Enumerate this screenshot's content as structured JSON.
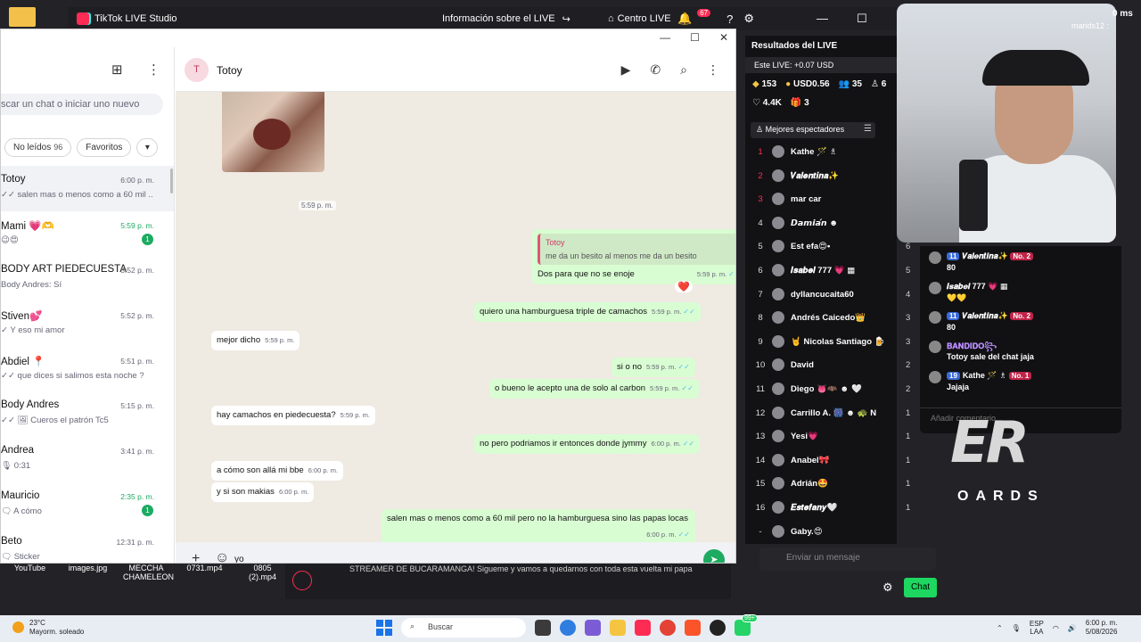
{
  "desktop": {
    "icons": [
      "YouTube",
      "images.jpg",
      "MECCHA CHAMELEON",
      "0731.mp4",
      "0805 (2).mp4"
    ]
  },
  "tiktok": {
    "title": "TikTok LIVE Studio",
    "info": "Información sobre el LIVE",
    "center": "Centro LIVE",
    "notif_count": "67",
    "stream_time": "0 ms"
  },
  "whatsapp": {
    "search_placeholder": "scar un chat o iniciar uno nuevo",
    "filters": [
      {
        "label": "No leídos",
        "count": "96"
      },
      {
        "label": "Favoritos"
      }
    ],
    "chats": [
      {
        "name": "Totoy",
        "time": "6:00 p. m.",
        "preview": "✓✓ salen mas o menos como a 60 mil ...",
        "unread": false
      },
      {
        "name": "Mami 💗🫶",
        "time": "5:59 p. m.",
        "preview": "😉😍",
        "unread": true,
        "badge": "1"
      },
      {
        "name": "BODY ART PIEDECUESTA",
        "time": "5:52 p. m.",
        "preview": "Body Andres: Sí",
        "unread": false
      },
      {
        "name": "Stiven💕",
        "time": "5:52 p. m.",
        "preview": "✓ Y eso mi amor",
        "unread": false
      },
      {
        "name": "Abdiel 📍",
        "time": "5:51 p. m.",
        "preview": "✓✓ que dices si salimos esta noche ?",
        "unread": false
      },
      {
        "name": "Body Andres",
        "time": "5:15 p. m.",
        "preview": "✓✓ 🖼 Cueros el patrón  Tc5",
        "unread": false
      },
      {
        "name": "Andrea",
        "time": "3:41 p. m.",
        "preview": "🎙 0:31",
        "unread": false
      },
      {
        "name": "Mauricio",
        "time": "2:35 p. m.",
        "preview": "🗨 A cómo",
        "unread": true,
        "badge": "1"
      },
      {
        "name": "Beto",
        "time": "12:31 p. m.",
        "preview": "🗨 Sticker",
        "unread": false
      }
    ],
    "conversation": {
      "avatar_letter": "T",
      "name": "Totoy",
      "photo_time": "5:59 p. m.",
      "quote_author": "Totoy",
      "quote_text": "me da un besito al menos me da un besito",
      "messages": [
        {
          "dir": "out",
          "text": "Dos para que no se enoje",
          "time": "5:59 p. m."
        },
        {
          "dir": "out",
          "text": "quiero una hamburguesa triple de camachos",
          "time": "5:59 p. m."
        },
        {
          "dir": "in",
          "text": "mejor dicho",
          "time": "5:59 p. m."
        },
        {
          "dir": "out",
          "text": "si o  no",
          "time": "5:59 p. m."
        },
        {
          "dir": "out",
          "text": "o  bueno le acepto una de solo al carbon",
          "time": "5:59 p. m."
        },
        {
          "dir": "in",
          "text": "hay camachos en piedecuesta?",
          "time": "5:59 p. m."
        },
        {
          "dir": "out",
          "text": "no pero podriamos ir entonces donde jymmy",
          "time": "6:00 p. m."
        },
        {
          "dir": "in",
          "text": "a cómo son allá mi bbe",
          "time": "6:00 p. m."
        },
        {
          "dir": "in",
          "text": "y si son makias",
          "time": "6:00 p. m."
        },
        {
          "dir": "out",
          "text": "salen mas o menos como a 60 mil pero no la hamburguesa sino las papas locas",
          "time": "6:00 p. m."
        }
      ],
      "reaction": "❤️",
      "composer_value": "yo"
    }
  },
  "live_panel": {
    "title": "Resultados del LIVE",
    "earnings": "Este LIVE: +0.07 USD",
    "stats": [
      {
        "icon": "diamond-icon",
        "value": "153"
      },
      {
        "icon": "coin-icon",
        "value": "USD0.56"
      },
      {
        "icon": "viewers-icon",
        "value": "35"
      },
      {
        "icon": "follow-icon",
        "value": "6"
      }
    ],
    "stats2": [
      {
        "icon": "heart-icon",
        "value": "4.4K"
      },
      {
        "icon": "gift-icon",
        "value": "3"
      }
    ],
    "tab": "Mejores espectadores",
    "viewers": [
      {
        "rank": "1",
        "name": "Kathe 🪄 ♗",
        "score": ""
      },
      {
        "rank": "2",
        "name": "𝑽𝒂𝒍𝒆𝒏𝒕𝒊𝒏𝒂✨",
        "score": ""
      },
      {
        "rank": "3",
        "name": "mar car",
        "score": ""
      },
      {
        "rank": "4",
        "name": "𝘿𝙖𝙢𝙞𝙖́𝙣 ☻",
        "score": ""
      },
      {
        "rank": "5",
        "name": "Est efa😍•",
        "score": "6"
      },
      {
        "rank": "6",
        "name": "𝑰𝒔𝒂𝒃𝒆𝒍 777 💗 ▦",
        "score": "5"
      },
      {
        "rank": "7",
        "name": "dyllancucaita60",
        "score": "4"
      },
      {
        "rank": "8",
        "name": "Andrés Caicedo👑",
        "score": "3"
      },
      {
        "rank": "9",
        "name": "🤘 Nicolas Santiago 🍺",
        "score": "3"
      },
      {
        "rank": "10",
        "name": "David",
        "score": "2"
      },
      {
        "rank": "11",
        "name": "Diego 👅🦇 ☻ 🤍",
        "score": "2"
      },
      {
        "rank": "12",
        "name": "Carrillo A. 🎆 ☻ 🐢 N",
        "score": "1"
      },
      {
        "rank": "13",
        "name": "Yesi💗",
        "score": "1"
      },
      {
        "rank": "14",
        "name": "Anabel🎀",
        "score": "1"
      },
      {
        "rank": "15",
        "name": "Adrián🤩",
        "score": "1"
      },
      {
        "rank": "16",
        "name": "𝑬𝒔𝒕𝒆𝒇𝒂𝒏𝒚🤍",
        "score": "1"
      },
      {
        "rank": "-",
        "name": "Gaby.😍",
        "score": ""
      }
    ]
  },
  "cam": {
    "user_label": "marids12 :"
  },
  "chat_overlay": {
    "items": [
      {
        "badge": "11",
        "tag": "No. 2",
        "name": "𝑽𝒂𝒍𝒆𝒏𝒕𝒊𝒏𝒂✨",
        "text": "80"
      },
      {
        "badge": "",
        "tag": "",
        "name": "𝑰𝒔𝒂𝒃𝒆𝒍 777 💗 ▦",
        "text": "💛💛"
      },
      {
        "badge": "11",
        "tag": "No. 2",
        "name": "𝑽𝒂𝒍𝒆𝒏𝒕𝒊𝒏𝒂✨",
        "text": "80"
      },
      {
        "badge": "",
        "tag": "",
        "name": "𝐁𝐀𝐍𝐃𝐈𝐃𝐎꧂",
        "text": "Totoy sale del chat jaja"
      },
      {
        "badge": "19",
        "tag": "No. 1",
        "name": "Kathe 🪄 ♗",
        "text": "Jajaja"
      }
    ],
    "input_placeholder": "Añadir comentario..."
  },
  "overlay_text": {
    "logo": "ER",
    "boards": "OARDS"
  },
  "live_controls": {
    "message_placeholder": "Enviar un mensaje",
    "chat_button": "Chat"
  },
  "banner": {
    "text": "STREAMER DE BUCARAMANGA! Sigueme y vamos a quedarnos con toda esta vuelta mi papa"
  },
  "taskbar": {
    "temp": "23°C",
    "weather": "Mayorm. soleado",
    "search": "Buscar",
    "lang1": "ESP",
    "lang2": "LAA",
    "time": "6:00 p. m.",
    "date": "5/08/2026",
    "badge": "99+"
  }
}
